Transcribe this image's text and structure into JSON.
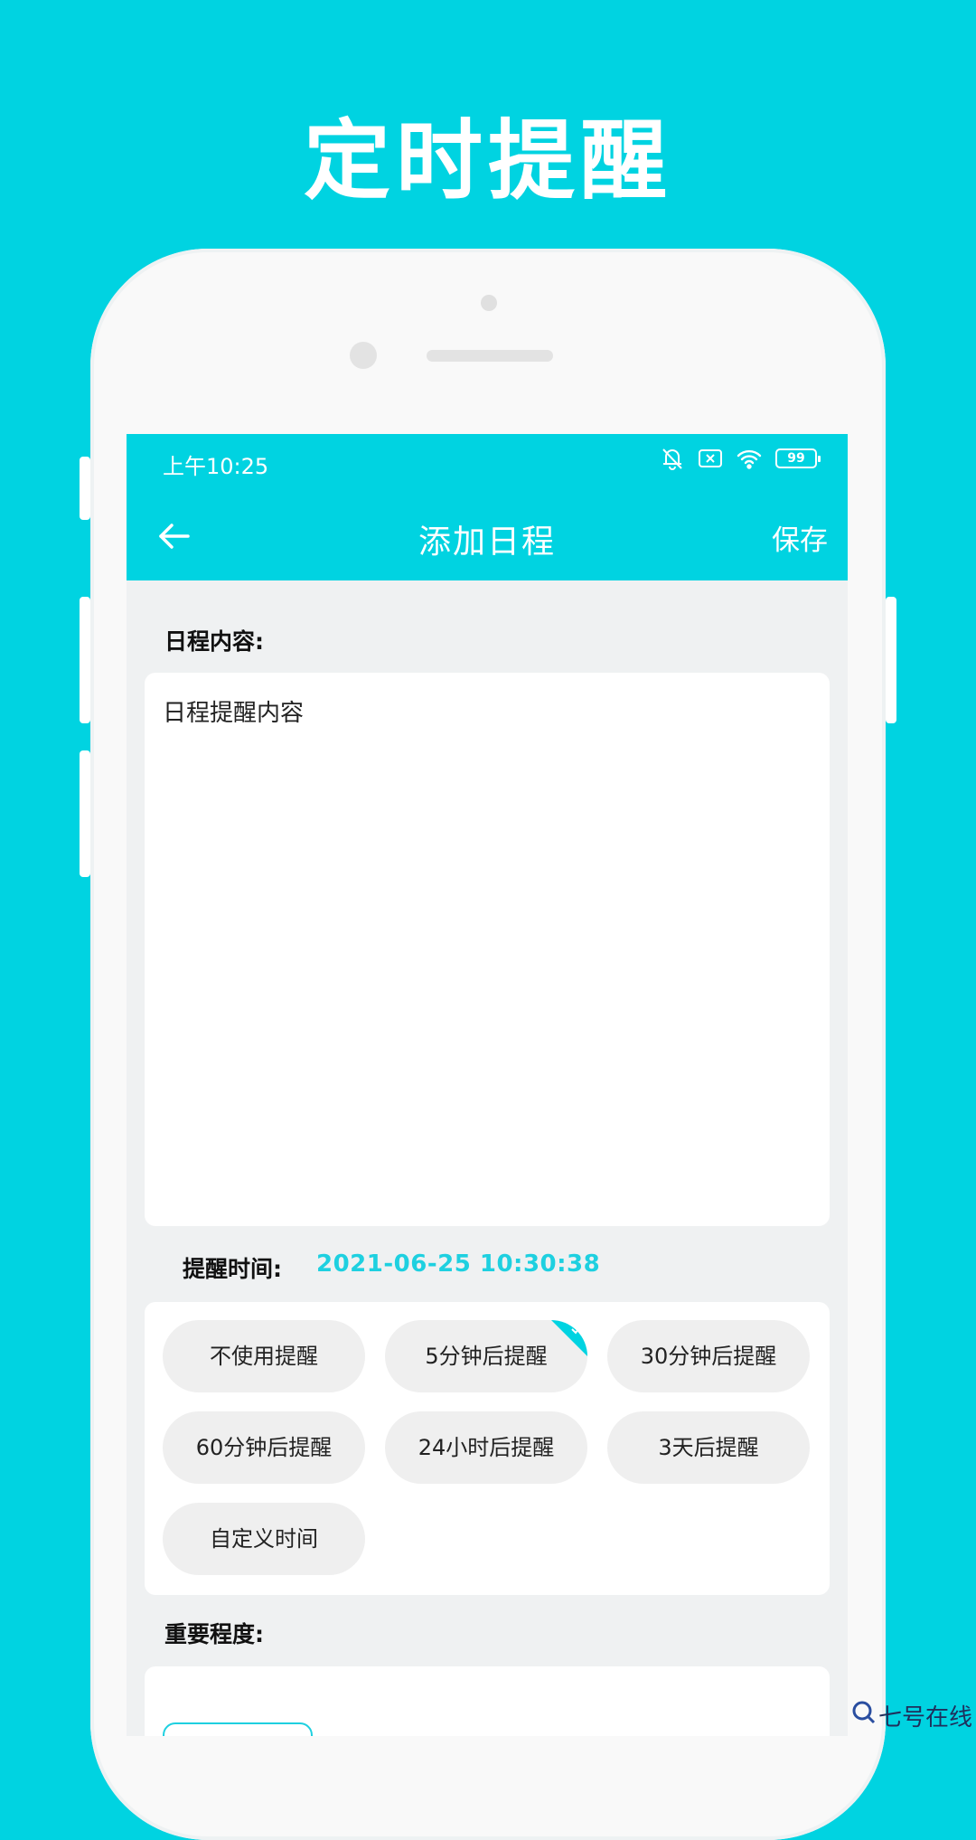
{
  "promo": {
    "title": "定时提醒"
  },
  "status_bar": {
    "time": "上午10:25",
    "battery": "99"
  },
  "app_bar": {
    "title": "添加日程",
    "save_label": "保存"
  },
  "content": {
    "label": "日程内容:",
    "text": "日程提醒内容"
  },
  "reminder": {
    "label": "提醒时间:",
    "time_value": "2021-06-25 10:30:38",
    "selected": "5分钟后提醒",
    "options": [
      "不使用提醒",
      "5分钟后提醒",
      "30分钟后提醒",
      "60分钟后提醒",
      "24小时后提醒",
      "3天后提醒",
      "自定义时间"
    ]
  },
  "importance": {
    "label": "重要程度:"
  },
  "watermark": {
    "text": "七号在线"
  },
  "colors": {
    "accent": "#00d3e1",
    "time_text": "#1ed0e0",
    "chip_bg": "#efefef",
    "page_bg": "#eff1f2"
  }
}
